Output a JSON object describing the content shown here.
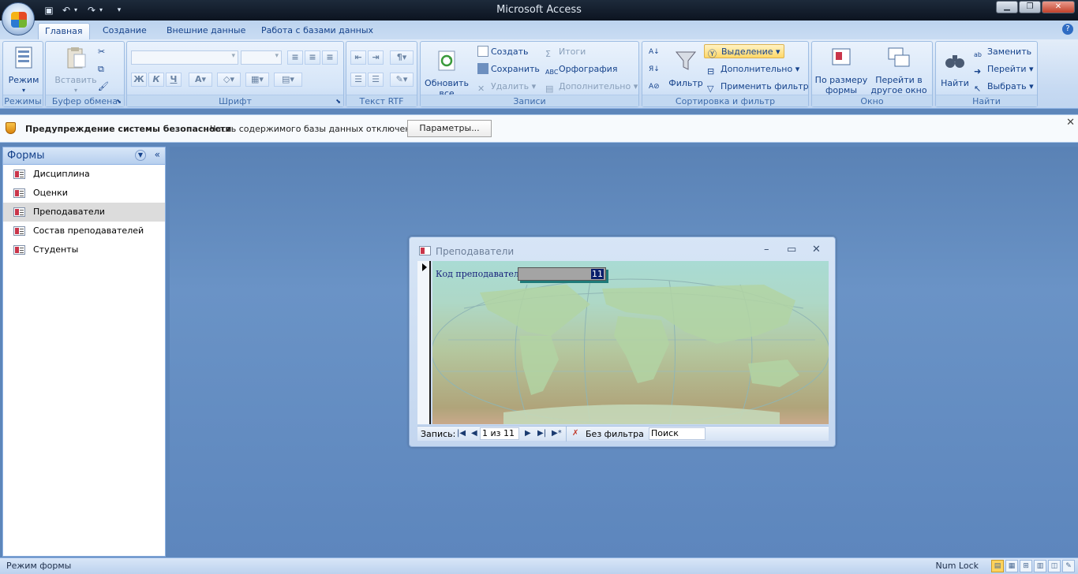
{
  "window": {
    "title": "Microsoft Access"
  },
  "tabs": [
    "Главная",
    "Создание",
    "Внешние данные",
    "Работа с базами данных"
  ],
  "ribbon": {
    "groups": {
      "modes": "Режимы",
      "clipboard": "Буфер обмена",
      "font": "Шрифт",
      "rtf": "Текст RTF",
      "records": "Записи",
      "sort_filter": "Сортировка и фильтр",
      "window": "Окно",
      "find": "Найти"
    },
    "mode_btn": "Режим",
    "paste_btn": "Вставить",
    "refresh_btn": "Обновить все",
    "create_btn": "Создать",
    "save_btn": "Сохранить",
    "delete_btn": "Удалить",
    "totals_btn": "Итоги",
    "spelling_btn": "Орфография",
    "more_btn": "Дополнительно",
    "filter_btn": "Фильтр",
    "selection_btn": "Выделение",
    "advanced_btn": "Дополнительно",
    "apply_filter_btn": "Применить фильтр",
    "fit_form_btn": "По размеру формы",
    "switch_window_btn": "Перейти в другое окно",
    "find_btn": "Найти",
    "replace_btn": "Заменить",
    "goto_btn": "Перейти",
    "select_btn": "Выбрать",
    "font_fmt": {
      "bold": "Ж",
      "italic": "К",
      "underline": "Ч"
    }
  },
  "security": {
    "title": "Предупреждение системы безопасности",
    "text": "Часть содержимого базы данных отключено",
    "button": "Параметры..."
  },
  "nav": {
    "title": "Формы",
    "items": [
      {
        "label": "Дисциплина"
      },
      {
        "label": "Оценки"
      },
      {
        "label": "Преподаватели"
      },
      {
        "label": "Состав преподавателей"
      },
      {
        "label": "Студенты"
      }
    ],
    "selected_index": 2
  },
  "form": {
    "title": "Преподаватели",
    "field_label": "Код преподавателя",
    "field_value": "11",
    "nav_label": "Запись:",
    "record": "1 из 11",
    "no_filter": "Без фильтра",
    "search": "Поиск"
  },
  "status": {
    "mode": "Режим формы",
    "numlock": "Num Lock"
  },
  "colors": {
    "accent": "#15428b",
    "workspace": "#5d86ba"
  }
}
